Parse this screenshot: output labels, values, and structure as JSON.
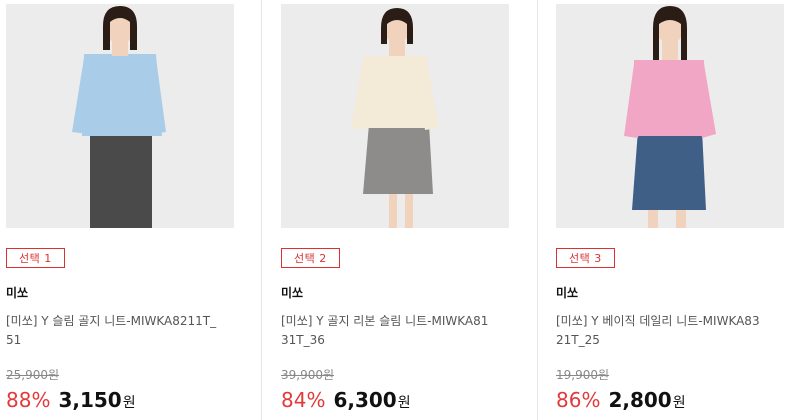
{
  "products": [
    {
      "badge": "선택 1",
      "brand": "미쏘",
      "title_line1": "[미쏘] Y 슬림 골지 니트-MIWKA8211T_",
      "title_line2": "51",
      "original_price": "25,900원",
      "discount": "88%",
      "price": "3,150",
      "price_unit": "원",
      "colors": {
        "top": "#a9cde8",
        "bottom": "#4a4a4a",
        "hair": "#2b1d16",
        "skin": "#f0d2bd"
      }
    },
    {
      "badge": "선택 2",
      "brand": "미쏘",
      "title_line1": "[미쏘] Y 골지 리본 슬림 니트-MIWKA81",
      "title_line2": "31T_36",
      "original_price": "39,900원",
      "discount": "84%",
      "price": "6,300",
      "price_unit": "원",
      "colors": {
        "top": "#f3ead8",
        "bottom": "#8e8c8a",
        "hair": "#2b1d16",
        "skin": "#f0d2bd"
      }
    },
    {
      "badge": "선택 3",
      "brand": "미쏘",
      "title_line1": "[미쏘] Y 베이직 데일리 니트-MIWKA83",
      "title_line2": "21T_25",
      "original_price": "19,900원",
      "discount": "86%",
      "price": "2,800",
      "price_unit": "원",
      "colors": {
        "top": "#f2a6c6",
        "bottom": "#3f5f86",
        "hair": "#2b1d16",
        "skin": "#f0d2bd"
      }
    }
  ]
}
